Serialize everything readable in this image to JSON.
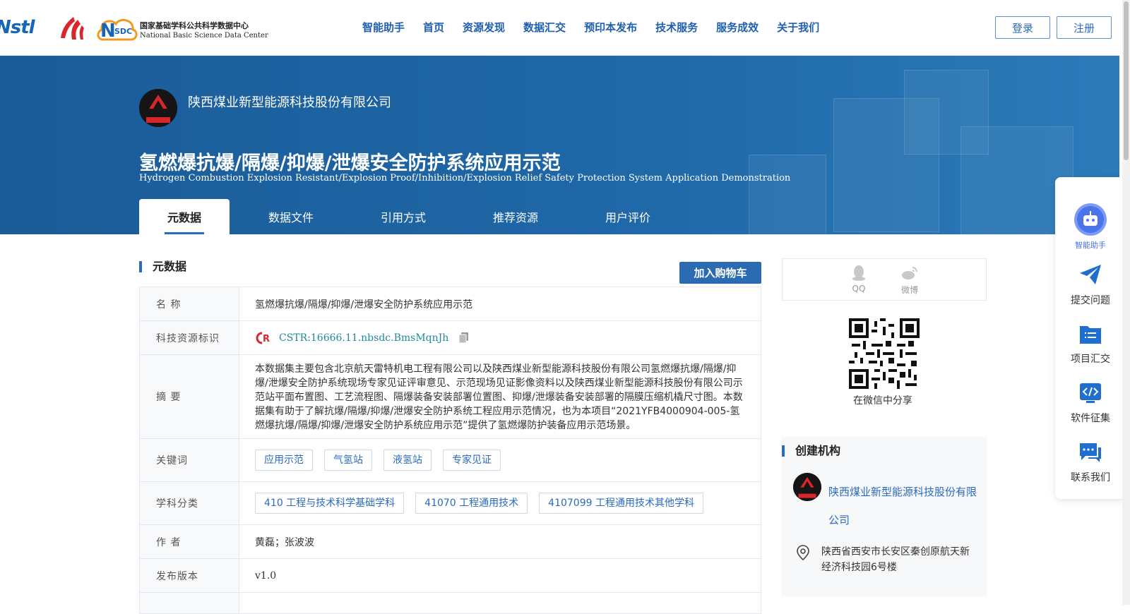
{
  "header": {
    "logo_nstl": "Nstl",
    "logo_nsdc_cn": "国家基础学科公共科学数据中心",
    "logo_nsdc_en": "National Basic Science Data Center",
    "nav": [
      "智能助手",
      "首页",
      "资源发现",
      "数据汇交",
      "预印本发布",
      "技术服务",
      "服务成效",
      "关于我们"
    ],
    "login": "登录",
    "register": "注册"
  },
  "banner": {
    "org_name": "陕西煤业新型能源科技股份有限公司",
    "title_cn": "氢燃爆抗爆/隔爆/抑爆/泄爆安全防护系统应用示范",
    "title_en": "Hydrogen Combustion Explosion Resistant/Explosion Proof/Inhibition/Explosion Relief Safety Protection System Application Demonstration",
    "tabs": [
      "元数据",
      "数据文件",
      "引用方式",
      "推荐资源",
      "用户评价"
    ]
  },
  "metadata": {
    "section_title": "元数据",
    "cart_button": "加入购物车",
    "rows": {
      "name": {
        "label": "名 称",
        "value": "氢燃爆抗爆/隔爆/抑爆/泄爆安全防护系统应用示范"
      },
      "cstr": {
        "label": "科技资源标识",
        "value": "CSTR:16666.11.nbsdc.BmsMqnJh"
      },
      "abstract": {
        "label": "摘 要",
        "value": "本数据集主要包含北京航天雷特机电工程有限公司以及陕西煤业新型能源科技股份有限公司氢燃爆抗爆/隔爆/抑爆/泄爆安全防护系统现场专家见证评审意见、示范现场见证影像资料以及陕西煤业新型能源科技股份有限公司示范站平面布置图、工艺流程图、隔爆装备安装部署位置图、抑爆/泄爆装备安装部署的隔膜压缩机橇尺寸图。本数据集有助于了解抗爆/隔爆/抑爆/泄爆安全防护系统工程应用示范情况，也为本项目“2021YFB4000904-005-氢燃爆抗爆/隔爆/抑爆/泄爆安全防护系统应用示范”提供了氢燃爆防护装备应用示范场景。"
      },
      "keywords": {
        "label": "关键词",
        "tags": [
          "应用示范",
          "气氢站",
          "液氢站",
          "专家见证"
        ]
      },
      "subjects": {
        "label": "学科分类",
        "tags": [
          "410 工程与技术科学基础学科",
          "41070 工程通用技术",
          "4107099 工程通用技术其他学科"
        ]
      },
      "authors": {
        "label": "作 者",
        "value": "黄磊；张波波"
      },
      "version": {
        "label": "发布版本",
        "value": "v1.0"
      }
    }
  },
  "sidebar": {
    "share_qq": "QQ",
    "share_weibo": "微博",
    "qr_caption": "在微信中分享",
    "org_section": "创建机构",
    "org_name": "陕西煤业新型能源科技股份有限公司",
    "org_address": "陕西省西安市长安区秦创原航天新经济科技园6号楼"
  },
  "float_tools": [
    "智能助手",
    "提交问题",
    "项目汇交",
    "软件征集",
    "联系我们"
  ],
  "colors": {
    "primary": "#2a6ac0",
    "banner": "#1e66a6",
    "cstr_link": "#1f8a9a"
  }
}
